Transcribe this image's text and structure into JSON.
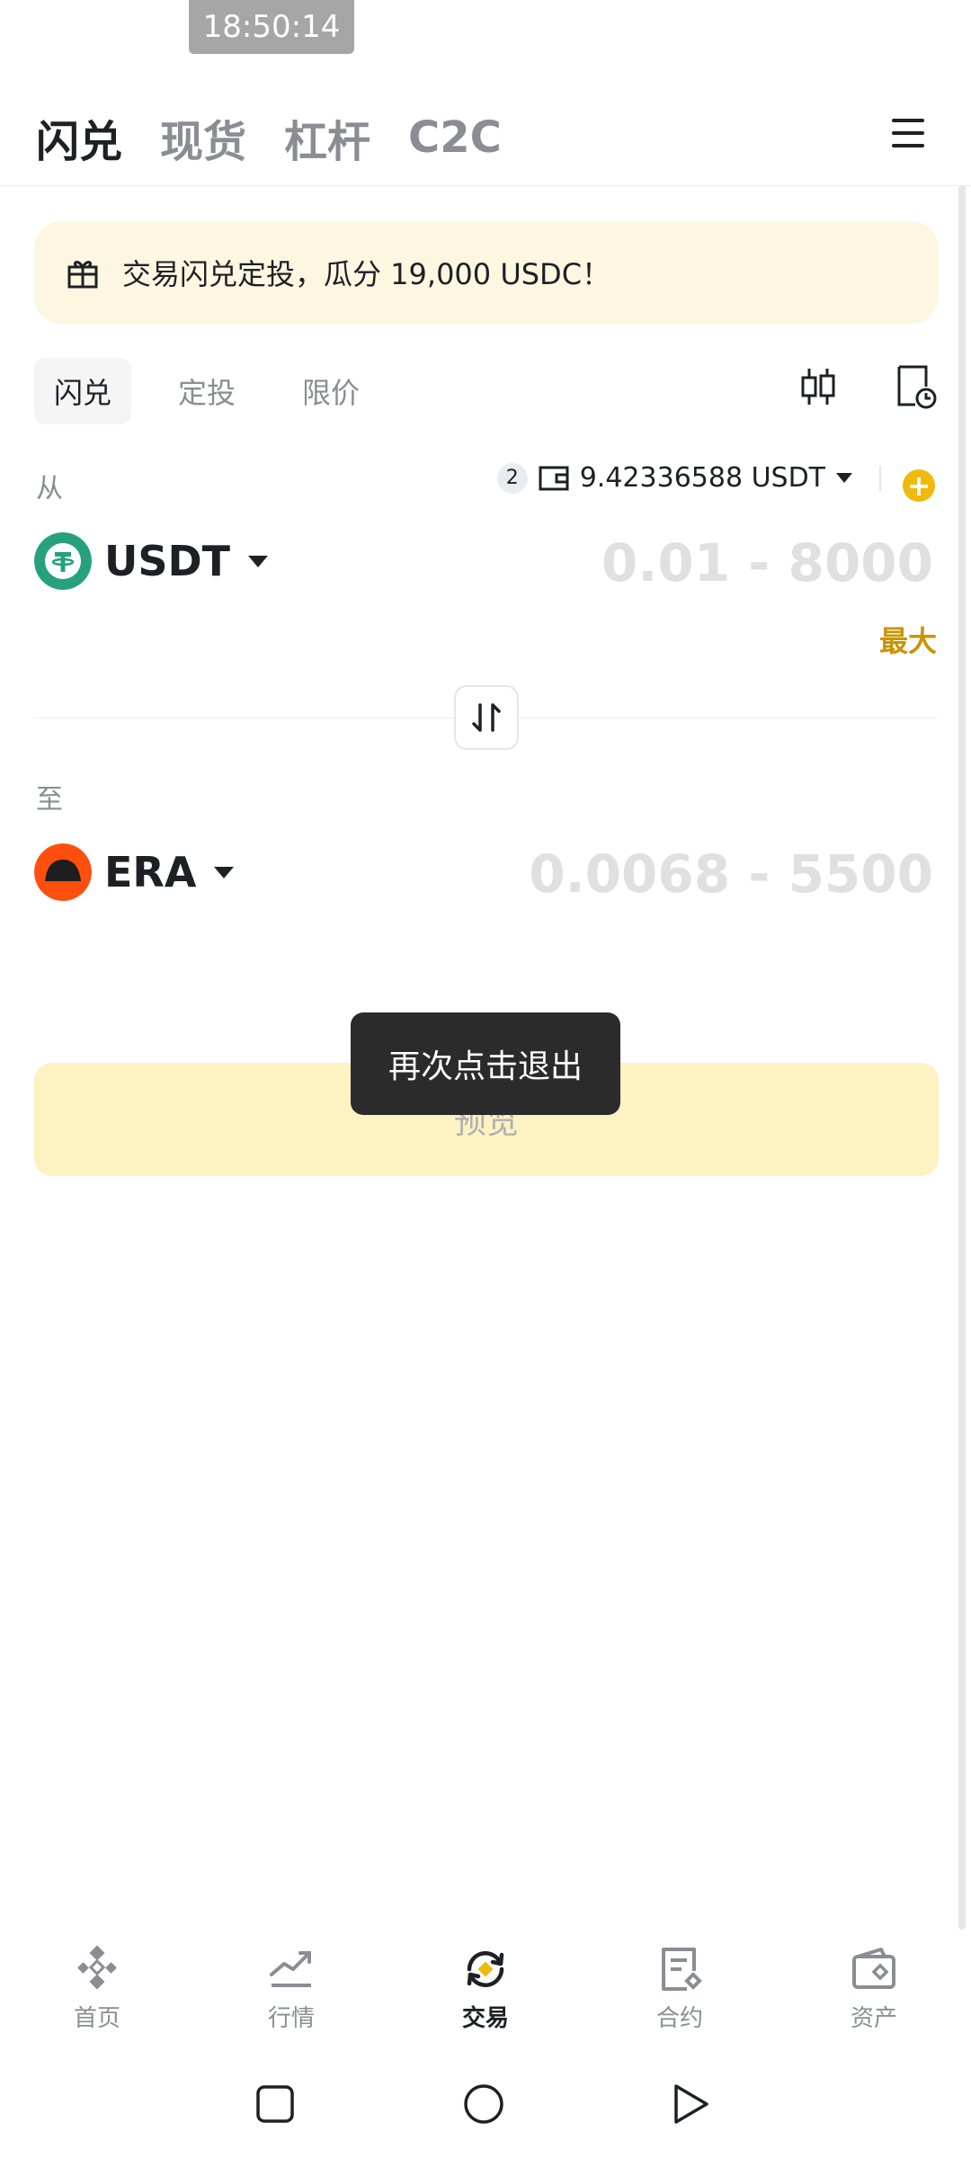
{
  "status": {
    "time": "18:50:14"
  },
  "top_tabs": [
    "闪兑",
    "现货",
    "杠杆",
    "C2C"
  ],
  "banner": {
    "text": "交易闪兑定投，瓜分 19,000 USDC！"
  },
  "sub_tabs": [
    "闪兑",
    "定投",
    "限价"
  ],
  "from": {
    "label": "从",
    "wallet_count": "2",
    "balance": "9.42336588 USDT",
    "coin": "USDT",
    "amount_hint": "0.01 - 8000",
    "max_label": "最大"
  },
  "to": {
    "label": "至",
    "coin": "ERA",
    "amount_hint": "0.0068 - 5500"
  },
  "preview_button": "预览",
  "toast": "再次点击退出",
  "bottom_nav": [
    "首页",
    "行情",
    "交易",
    "合约",
    "资产"
  ],
  "colors": {
    "accent": "#F0B90B",
    "max_text": "#C99400",
    "usdt": "#26A17B",
    "era": "#FF4F0F"
  }
}
